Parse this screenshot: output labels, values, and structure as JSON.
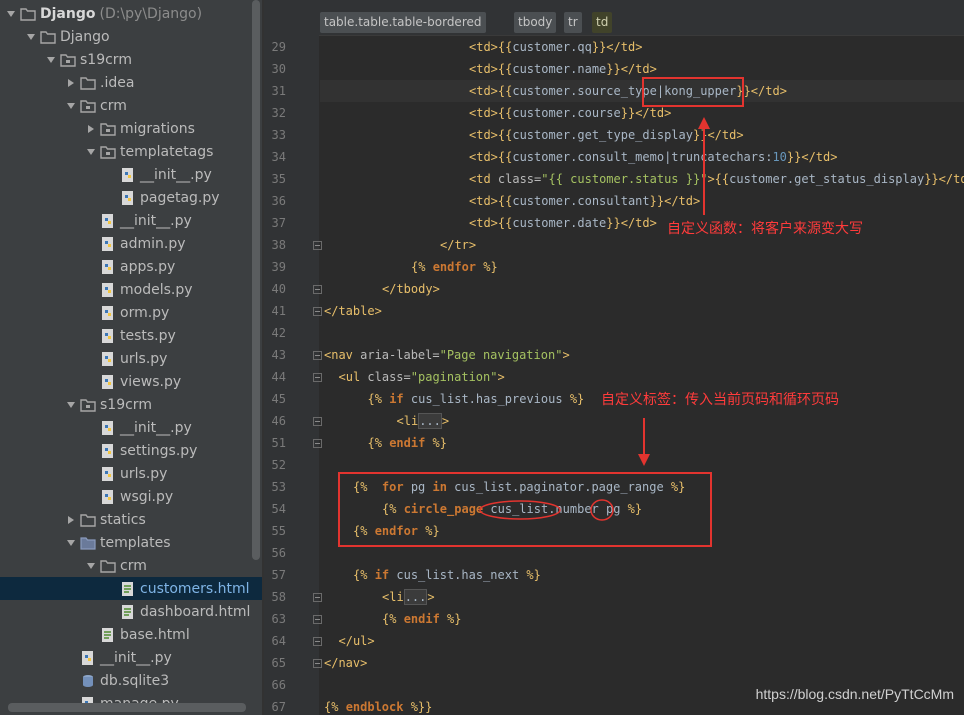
{
  "project_tree": {
    "rows": [
      {
        "indent": 0,
        "arrow": "down",
        "icon": "folder-icon",
        "label": "Django",
        "bold": true,
        "path": "(D:\\py\\Django)"
      },
      {
        "indent": 1,
        "arrow": "down",
        "icon": "folder-icon",
        "label": "Django"
      },
      {
        "indent": 2,
        "arrow": "down",
        "icon": "package-folder-icon",
        "label": "s19crm"
      },
      {
        "indent": 3,
        "arrow": "right",
        "icon": "folder-icon",
        "label": ".idea"
      },
      {
        "indent": 3,
        "arrow": "down",
        "icon": "package-folder-icon",
        "label": "crm"
      },
      {
        "indent": 4,
        "arrow": "right",
        "icon": "package-folder-icon",
        "label": "migrations"
      },
      {
        "indent": 4,
        "arrow": "down",
        "icon": "package-folder-icon",
        "label": "templatetags"
      },
      {
        "indent": 5,
        "arrow": "none",
        "icon": "python-file-icon",
        "label": "__init__.py"
      },
      {
        "indent": 5,
        "arrow": "none",
        "icon": "python-file-icon",
        "label": "pagetag.py"
      },
      {
        "indent": 4,
        "arrow": "none",
        "icon": "python-file-icon",
        "label": "__init__.py"
      },
      {
        "indent": 4,
        "arrow": "none",
        "icon": "python-file-icon",
        "label": "admin.py"
      },
      {
        "indent": 4,
        "arrow": "none",
        "icon": "python-file-icon",
        "label": "apps.py"
      },
      {
        "indent": 4,
        "arrow": "none",
        "icon": "python-file-icon",
        "label": "models.py"
      },
      {
        "indent": 4,
        "arrow": "none",
        "icon": "python-file-icon",
        "label": "orm.py"
      },
      {
        "indent": 4,
        "arrow": "none",
        "icon": "python-file-icon",
        "label": "tests.py"
      },
      {
        "indent": 4,
        "arrow": "none",
        "icon": "python-file-icon",
        "label": "urls.py"
      },
      {
        "indent": 4,
        "arrow": "none",
        "icon": "python-file-icon",
        "label": "views.py"
      },
      {
        "indent": 3,
        "arrow": "down",
        "icon": "package-folder-icon",
        "label": "s19crm"
      },
      {
        "indent": 4,
        "arrow": "none",
        "icon": "python-file-icon",
        "label": "__init__.py"
      },
      {
        "indent": 4,
        "arrow": "none",
        "icon": "python-file-icon",
        "label": "settings.py"
      },
      {
        "indent": 4,
        "arrow": "none",
        "icon": "python-file-icon",
        "label": "urls.py"
      },
      {
        "indent": 4,
        "arrow": "none",
        "icon": "python-file-icon",
        "label": "wsgi.py"
      },
      {
        "indent": 3,
        "arrow": "right",
        "icon": "folder-icon",
        "label": "statics"
      },
      {
        "indent": 3,
        "arrow": "down",
        "icon": "templates-folder-icon",
        "label": "templates"
      },
      {
        "indent": 4,
        "arrow": "down",
        "icon": "folder-icon",
        "label": "crm"
      },
      {
        "indent": 5,
        "arrow": "none",
        "icon": "html-file-icon",
        "label": "customers.html",
        "selected": true
      },
      {
        "indent": 5,
        "arrow": "none",
        "icon": "html-file-icon",
        "label": "dashboard.html"
      },
      {
        "indent": 4,
        "arrow": "none",
        "icon": "html-file-icon",
        "label": "base.html"
      },
      {
        "indent": 3,
        "arrow": "none",
        "icon": "python-file-icon",
        "label": "__init__.py"
      },
      {
        "indent": 3,
        "arrow": "none",
        "icon": "database-file-icon",
        "label": "db.sqlite3"
      },
      {
        "indent": 3,
        "arrow": "none",
        "icon": "python-file-icon",
        "label": "manage.py"
      }
    ]
  },
  "breadcrumbs": [
    "table.table.table-bordered",
    "tbody",
    "tr",
    "td"
  ],
  "editor": {
    "current_line": "31",
    "lines": [
      {
        "n": "29",
        "indent": 20,
        "tokens": [
          [
            "tag",
            "<td>"
          ],
          [
            "tmpl",
            "{{"
          ],
          [
            "var",
            "customer.qq"
          ],
          [
            "tmpl",
            "}}"
          ],
          [
            "tag",
            "</td>"
          ]
        ]
      },
      {
        "n": "30",
        "indent": 20,
        "tokens": [
          [
            "tag",
            "<td>"
          ],
          [
            "tmpl",
            "{{"
          ],
          [
            "var",
            "customer.name"
          ],
          [
            "tmpl",
            "}}"
          ],
          [
            "tag",
            "</td>"
          ]
        ]
      },
      {
        "n": "31",
        "indent": 20,
        "tokens": [
          [
            "tag",
            "<td>"
          ],
          [
            "tmpl",
            "{{"
          ],
          [
            "var",
            "customer.source_type"
          ],
          [
            "var",
            "|kong_upper"
          ],
          [
            "tmpl",
            "}}"
          ],
          [
            "tag",
            "</td>"
          ]
        ]
      },
      {
        "n": "32",
        "indent": 20,
        "tokens": [
          [
            "tag",
            "<td>"
          ],
          [
            "tmpl",
            "{{"
          ],
          [
            "var",
            "customer.course"
          ],
          [
            "tmpl",
            "}}"
          ],
          [
            "tag",
            "</td>"
          ]
        ]
      },
      {
        "n": "33",
        "indent": 20,
        "tokens": [
          [
            "tag",
            "<td>"
          ],
          [
            "tmpl",
            "{{"
          ],
          [
            "var",
            "customer.get_type_display"
          ],
          [
            "tmpl",
            "}}"
          ],
          [
            "tag",
            "</td>"
          ]
        ]
      },
      {
        "n": "34",
        "indent": 20,
        "tokens": [
          [
            "tag",
            "<td>"
          ],
          [
            "tmpl",
            "{{"
          ],
          [
            "var",
            "customer.consult_memo|truncatechars:"
          ],
          [
            "num",
            "10"
          ],
          [
            "tmpl",
            "}}"
          ],
          [
            "tag",
            "</td>"
          ]
        ]
      },
      {
        "n": "35",
        "indent": 20,
        "tokens": [
          [
            "tag",
            "<td "
          ],
          [
            "attr",
            "class="
          ],
          [
            "str",
            "\"{{ customer.status }}\""
          ],
          [
            "tag",
            ">"
          ],
          [
            "tmpl",
            "{{"
          ],
          [
            "var",
            "customer.get_status_display"
          ],
          [
            "tmpl",
            "}}"
          ],
          [
            "tag",
            "</td>"
          ]
        ]
      },
      {
        "n": "36",
        "indent": 20,
        "tokens": [
          [
            "tag",
            "<td>"
          ],
          [
            "tmpl",
            "{{"
          ],
          [
            "var",
            "customer.consultant"
          ],
          [
            "tmpl",
            "}}"
          ],
          [
            "tag",
            "</td>"
          ]
        ]
      },
      {
        "n": "37",
        "indent": 20,
        "tokens": [
          [
            "tag",
            "<td>"
          ],
          [
            "tmpl",
            "{{"
          ],
          [
            "var",
            "customer.date"
          ],
          [
            "tmpl",
            "}}"
          ],
          [
            "tag",
            "</td>"
          ]
        ]
      },
      {
        "n": "38",
        "indent": 16,
        "tokens": [
          [
            "tag",
            "</tr>"
          ]
        ]
      },
      {
        "n": "39",
        "indent": 12,
        "tokens": [
          [
            "tmpl",
            "{% "
          ],
          [
            "kw",
            "endfor"
          ],
          [
            "tmpl",
            " %}"
          ]
        ]
      },
      {
        "n": "40",
        "indent": 8,
        "tokens": [
          [
            "tag",
            "</tbody>"
          ]
        ]
      },
      {
        "n": "41",
        "indent": 0,
        "tokens": [
          [
            "tag",
            "</table>"
          ]
        ]
      },
      {
        "n": "42",
        "indent": 0,
        "tokens": []
      },
      {
        "n": "43",
        "indent": 0,
        "tokens": [
          [
            "tag",
            "<nav "
          ],
          [
            "attr",
            "aria-label="
          ],
          [
            "str",
            "\"Page navigation\""
          ],
          [
            "tag",
            ">"
          ]
        ]
      },
      {
        "n": "44",
        "indent": 2,
        "tokens": [
          [
            "tag",
            "<ul "
          ],
          [
            "attr",
            "class="
          ],
          [
            "str",
            "\"pagination\""
          ],
          [
            "tag",
            ">"
          ]
        ]
      },
      {
        "n": "45",
        "indent": 6,
        "tokens": [
          [
            "tmpl",
            "{% "
          ],
          [
            "kw",
            "if"
          ],
          [
            "var",
            " cus_list.has_previous "
          ],
          [
            "tmpl",
            "%}"
          ]
        ]
      },
      {
        "n": "46",
        "indent": 10,
        "tokens": [
          [
            "tag",
            "<li"
          ],
          [
            "fold",
            "..."
          ],
          [
            "tag",
            ">"
          ]
        ]
      },
      {
        "n": "51",
        "indent": 6,
        "tokens": [
          [
            "tmpl",
            "{% "
          ],
          [
            "kw",
            "endif"
          ],
          [
            "tmpl",
            " %}"
          ]
        ]
      },
      {
        "n": "52",
        "indent": 0,
        "tokens": []
      },
      {
        "n": "53",
        "indent": 4,
        "tokens": [
          [
            "tmpl",
            "{%  "
          ],
          [
            "kw",
            "for"
          ],
          [
            "var",
            " pg "
          ],
          [
            "kw",
            "in"
          ],
          [
            "var",
            " cus_list.paginator.page_range "
          ],
          [
            "tmpl",
            "%}"
          ]
        ]
      },
      {
        "n": "54",
        "indent": 8,
        "tokens": [
          [
            "tmpl",
            "{% "
          ],
          [
            "kw",
            "circle_page"
          ],
          [
            "var",
            " cus_list.number pg "
          ],
          [
            "tmpl",
            "%}"
          ]
        ]
      },
      {
        "n": "55",
        "indent": 4,
        "tokens": [
          [
            "tmpl",
            "{% "
          ],
          [
            "kw",
            "endfor"
          ],
          [
            "tmpl",
            " %}"
          ]
        ]
      },
      {
        "n": "56",
        "indent": 0,
        "tokens": []
      },
      {
        "n": "57",
        "indent": 4,
        "tokens": [
          [
            "tmpl",
            "{% "
          ],
          [
            "kw",
            "if"
          ],
          [
            "var",
            " cus_list.has_next "
          ],
          [
            "tmpl",
            "%}"
          ]
        ]
      },
      {
        "n": "58",
        "indent": 8,
        "tokens": [
          [
            "tag",
            "<li"
          ],
          [
            "fold",
            "..."
          ],
          [
            "tag",
            ">"
          ]
        ]
      },
      {
        "n": "63",
        "indent": 8,
        "tokens": [
          [
            "tmpl",
            "{% "
          ],
          [
            "kw",
            "endif"
          ],
          [
            "tmpl",
            " %}"
          ]
        ]
      },
      {
        "n": "64",
        "indent": 2,
        "tokens": [
          [
            "tag",
            "</ul>"
          ]
        ]
      },
      {
        "n": "65",
        "indent": 0,
        "tokens": [
          [
            "tag",
            "</nav>"
          ]
        ]
      },
      {
        "n": "66",
        "indent": 0,
        "tokens": []
      },
      {
        "n": "67",
        "indent": 0,
        "tokens": [
          [
            "tmpl",
            "{% "
          ],
          [
            "kw",
            "endblock"
          ],
          [
            "tmpl",
            " %}"
          ],
          [
            "tmpl",
            "}"
          ]
        ]
      }
    ]
  },
  "annotations": {
    "filter_note": "自定义函数：将客户来源变大写",
    "tag_note": "自定义标签：传入当前页码和循环页码"
  },
  "colors": {
    "annotation": "#e3342f",
    "selection": "#0d293e"
  },
  "watermark": "https://blog.csdn.net/PyTtCcMm"
}
